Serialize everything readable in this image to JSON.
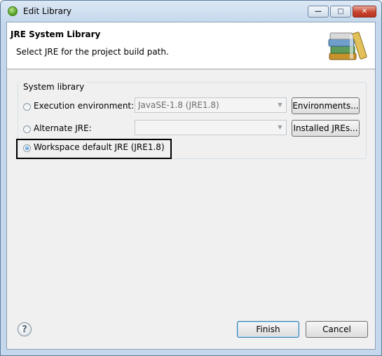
{
  "window": {
    "title": "Edit Library",
    "controls": {
      "minimize": "—",
      "maximize": "□",
      "close": "✕"
    }
  },
  "header": {
    "title": "JRE System Library",
    "description": "Select JRE for the project build path."
  },
  "group": {
    "label": "System library",
    "execution_environment": {
      "label": "Execution environment:",
      "value": "JavaSE-1.8 (JRE1.8)",
      "button": "Environments...",
      "selected": false
    },
    "alternate_jre": {
      "label": "Alternate JRE:",
      "value": "",
      "button": "Installed JREs...",
      "selected": false
    },
    "workspace_default": {
      "label": "Workspace default JRE (JRE1.8)",
      "selected": true
    }
  },
  "footer": {
    "help": "?",
    "finish": "Finish",
    "cancel": "Cancel"
  },
  "icons": {
    "app": "eclipse-spring-icon",
    "header": "library-books-icon",
    "help": "help-icon",
    "dropdown": "chevron-down-icon"
  }
}
